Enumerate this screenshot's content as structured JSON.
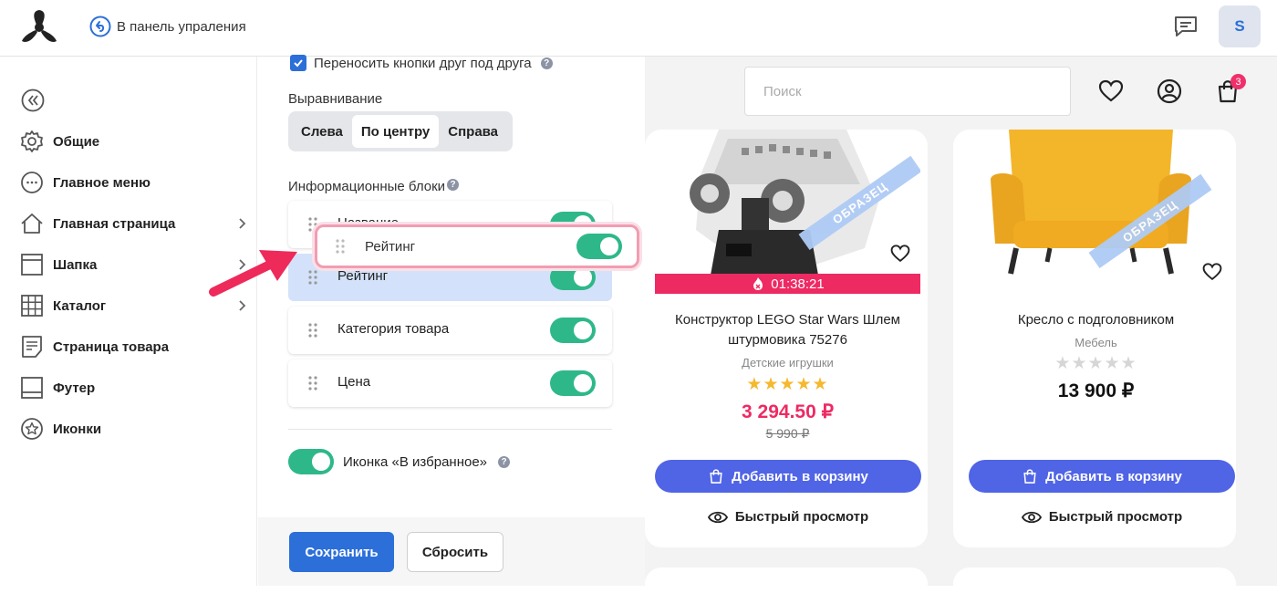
{
  "topbar": {
    "back_label": "В панель упраления",
    "avatar_letter": "S"
  },
  "sidebar": {
    "items": [
      {
        "label": "Общие",
        "icon": "gear-icon"
      },
      {
        "label": "Главное меню",
        "icon": "dots-circle-icon"
      },
      {
        "label": "Главная страница",
        "icon": "home-icon",
        "submenu": true
      },
      {
        "label": "Шапка",
        "icon": "header-layout-icon",
        "submenu": true
      },
      {
        "label": "Каталог",
        "icon": "grid-icon",
        "submenu": true
      },
      {
        "label": "Страница товара",
        "icon": "document-icon"
      },
      {
        "label": "Футер",
        "icon": "footer-layout-icon"
      },
      {
        "label": "Иконки",
        "icon": "star-circle-icon"
      }
    ]
  },
  "settings": {
    "wrap_buttons_label": "Переносить кнопки друг под друга",
    "align_label": "Выравнивание",
    "align_options": [
      "Слева",
      "По центру",
      "Справа"
    ],
    "align_selected": "По центру",
    "info_blocks_label": "Информационные блоки",
    "blocks": [
      {
        "label": "Название",
        "enabled": true
      },
      {
        "label": "Рейтинг",
        "enabled": true
      },
      {
        "label": "Категория товара",
        "enabled": true
      },
      {
        "label": "Цена",
        "enabled": true
      }
    ],
    "dragging_label": "Рейтинг",
    "favorite_label": "Иконка «В избранное»",
    "save_label": "Сохранить",
    "reset_label": "Сбросить"
  },
  "preview": {
    "search_placeholder": "Поиск",
    "cart_count": "3",
    "products": [
      {
        "name": "Конструктор LEGO Star Wars Шлем штурмовика 75276",
        "category": "Детские игрушки",
        "timer": "01:38:21",
        "price": "3 294.50 ₽",
        "old_price": "5 990 ₽",
        "rating": 5,
        "stamp": "ОБРАЗЕЦ"
      },
      {
        "name": "Кресло с подголовником",
        "category": "Мебель",
        "price": "13 900 ₽",
        "rating": 0,
        "stamp": "ОБРАЗЕЦ"
      }
    ],
    "add_to_cart_label": "Добавить в корзину",
    "quick_view_label": "Быстрый просмотр"
  },
  "colors": {
    "accent": "#2c6fd9",
    "toggle": "#2eb88a",
    "sale": "#ee2a63",
    "cart_button": "#5064e6",
    "star": "#f5b82e"
  }
}
